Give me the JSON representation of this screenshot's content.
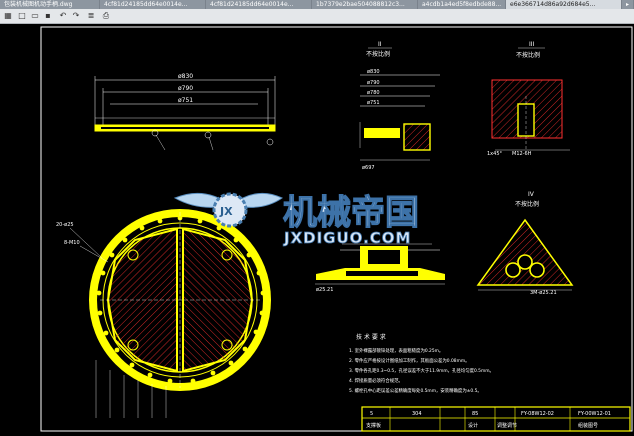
{
  "tabs": [
    {
      "label": "包装机械图机动手柄.dwg",
      "active": false
    },
    {
      "label": "4cf81d24185dd64e0014e...",
      "active": false
    },
    {
      "label": "4cf81d24185dd64e0014e...",
      "active": false
    },
    {
      "label": "1b7379e2bae504088812c3...",
      "active": false
    },
    {
      "label": "a4cdb1a4ed5f8edbde88...",
      "active": false
    },
    {
      "label": "e6e366714d86a92d684e5...",
      "active": true
    }
  ],
  "toolbar": {
    "icons": [
      "app-menu-icon",
      "new-file-icon",
      "open-icon",
      "save-icon",
      "undo-icon",
      "redo-icon",
      "layer-icon",
      "print-icon"
    ]
  },
  "views": {
    "II": {
      "label": "II",
      "scale": "不按比例"
    },
    "III": {
      "label": "III",
      "scale": "不按比例"
    },
    "IV": {
      "label": "IV",
      "scale": "不按比例"
    }
  },
  "dims": {
    "d830": "ø830",
    "d790": "ø790",
    "d751": "ø751",
    "r830": "ø830",
    "r790": "ø790",
    "r780": "ø780",
    "r751": "ø751",
    "d697": "ø697",
    "angle45": "1x45°",
    "thread": "M12-6H",
    "hole20": "20-ø25",
    "hole8": "8-M10",
    "edge": "ø25.21",
    "bottom": "3M-ø25.21"
  },
  "notes": {
    "title": "技 术 要 求",
    "lines": [
      "1. 室外裸露部镀锌处理，表面粗糙度为0.25m。",
      "2. 零件应严格按设计图纸加工制作，其板面公差为0.08mm。",
      "3. 零件各孔距0.3~0.5，孔径误差不大于11.9mm，孔径均匀度0.5mm。",
      "4. 焊接质量必须符合规范。",
      "5. 螺栓孔中心距误差公差精确度每处0.5mm，安装精确度为±0.5。"
    ]
  },
  "titleblock": {
    "r1": [
      "5",
      "304",
      "85",
      "FY-08W12-02",
      "FY-00W12-01"
    ],
    "r2": [
      "支撑板",
      "",
      "设计",
      "调整调节",
      "",
      "组装图号"
    ]
  },
  "watermark": {
    "brand": "机械帝国",
    "domain": "JXDIGUO.COM",
    "logo": "JX"
  },
  "colors": {
    "bg": "#000000",
    "yellow": "#ffff00",
    "red": "#ff2020",
    "white": "#ffffff",
    "hatch": "#ff3030"
  }
}
